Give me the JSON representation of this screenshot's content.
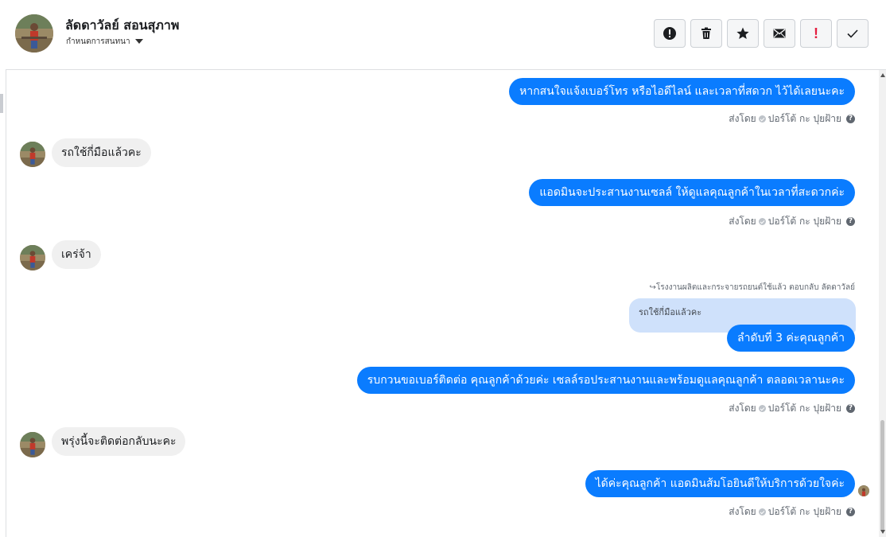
{
  "header": {
    "name": "ลัดดาวัลย์ สอนสุภาพ",
    "subtitle": "กำหนดการสนทนา",
    "actions": [
      {
        "icon": "warning-icon",
        "label": "report-spam"
      },
      {
        "icon": "trash-icon",
        "label": "delete"
      },
      {
        "icon": "star-icon",
        "label": "star"
      },
      {
        "icon": "envelope-icon",
        "label": "mark-unread"
      },
      {
        "icon": "exclamation-icon",
        "label": "follow-up"
      },
      {
        "icon": "check-icon",
        "label": "done"
      }
    ]
  },
  "sent_by": {
    "prefix": "ส่งโดย",
    "sender": "ปอร์โต้ กะ ปุยฝ้าย"
  },
  "messages": [
    {
      "dir": "out",
      "text": "หากสนใจแจ้งเบอร์โทร หรือไอดีไลน์ และเวลาที่สดวก ไว้ได้เลยนะคะ"
    },
    {
      "dir": "in",
      "text": "รถใช้กี่มือแล้วคะ"
    },
    {
      "dir": "out",
      "text": "แอดมินจะประสานงานเซลล์ ให้ดูแลคุณลูกค้าในเวลาที่สะดวกค่ะ"
    },
    {
      "dir": "in",
      "text": "เคร่จ้า"
    },
    {
      "dir": "out",
      "text": "ลำดับที่ 3 ค่ะคุณลูกค้า"
    },
    {
      "dir": "out",
      "text": "รบกวนขอเบอร์ติดต่อ คุณลูกค้าด้วยค่ะ เซลล์รอประสานงานและพร้อมดูแลคุณลูกค้า ตลอดเวลานะคะ"
    },
    {
      "dir": "in",
      "text": "พรุ่งนี้จะติดต่อกลับนะคะ"
    },
    {
      "dir": "out",
      "text": "ได้ค่ะคุณลูกค้า แอดมินส้มโอยินดีให้บริการด้วยใจค่ะ"
    }
  ],
  "reply": {
    "meta": "โรงงานผลิตและกระจายรถยนต์ใช้แล้ว ตอบกลับ ลัดดาวัลย์",
    "quoted": "รถใช้กี่มือแล้วคะ"
  },
  "colors": {
    "outgoing_bubble": "#0a7cff",
    "incoming_bubble": "#f0f0f0",
    "quote_bubble": "#cfe1fb"
  }
}
